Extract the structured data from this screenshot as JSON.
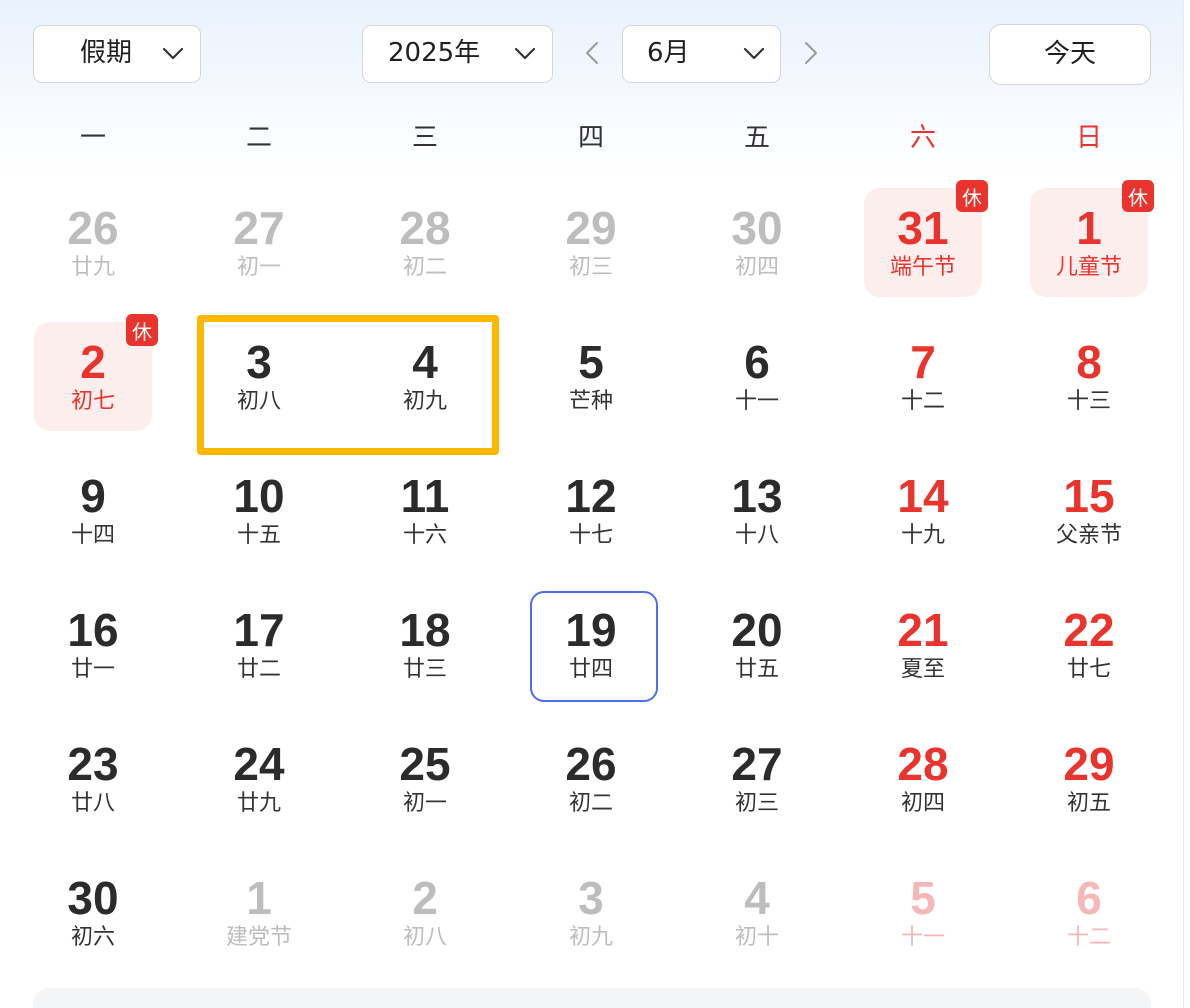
{
  "toolbar": {
    "holiday_select": {
      "value": "假期"
    },
    "year_select": {
      "value": "2025年"
    },
    "month_select": {
      "value": "6月"
    },
    "today_button": {
      "label": "今天"
    }
  },
  "icons": {
    "dropdown": "chevron-down-icon",
    "prev_month": "chevron-left-icon",
    "next_month": "chevron-right-icon"
  },
  "colors": {
    "text": "#2b2b2b",
    "muted": "#bdbdbd",
    "red": "#e8342d",
    "red_muted": "#f5b7b7",
    "holiday_bg": "#fdeeee",
    "badge_bg": "#e8342d",
    "range_border": "#ffb800",
    "today_border": "#4d6ef0"
  },
  "rest_badge": "休",
  "weekdays": [
    {
      "label": "一"
    },
    {
      "label": "二"
    },
    {
      "label": "三"
    },
    {
      "label": "四"
    },
    {
      "label": "五"
    },
    {
      "label": "六",
      "red": true
    },
    {
      "label": "日",
      "red": true
    }
  ],
  "weeks": [
    [
      {
        "day": "26",
        "lunar": "廿九",
        "muted": true
      },
      {
        "day": "27",
        "lunar": "初一",
        "muted": true
      },
      {
        "day": "28",
        "lunar": "初二",
        "muted": true
      },
      {
        "day": "29",
        "lunar": "初三",
        "muted": true
      },
      {
        "day": "30",
        "lunar": "初四",
        "muted": true
      },
      {
        "day": "31",
        "lunar": "端午节",
        "rest": true
      },
      {
        "day": "1",
        "lunar": "儿童节",
        "rest": true
      }
    ],
    [
      {
        "day": "2",
        "lunar": "初七",
        "rest": true
      },
      {
        "day": "3",
        "lunar": "初八",
        "range_start": true
      },
      {
        "day": "4",
        "lunar": "初九",
        "range_end": true
      },
      {
        "day": "5",
        "lunar": "芒种"
      },
      {
        "day": "6",
        "lunar": "十一"
      },
      {
        "day": "7",
        "lunar": "十二",
        "weekend": true
      },
      {
        "day": "8",
        "lunar": "十三",
        "weekend": true
      }
    ],
    [
      {
        "day": "9",
        "lunar": "十四"
      },
      {
        "day": "10",
        "lunar": "十五"
      },
      {
        "day": "11",
        "lunar": "十六"
      },
      {
        "day": "12",
        "lunar": "十七"
      },
      {
        "day": "13",
        "lunar": "十八"
      },
      {
        "day": "14",
        "lunar": "十九",
        "weekend": true
      },
      {
        "day": "15",
        "lunar": "父亲节",
        "weekend": true
      }
    ],
    [
      {
        "day": "16",
        "lunar": "廿一"
      },
      {
        "day": "17",
        "lunar": "廿二"
      },
      {
        "day": "18",
        "lunar": "廿三"
      },
      {
        "day": "19",
        "lunar": "廿四",
        "today": true
      },
      {
        "day": "20",
        "lunar": "廿五"
      },
      {
        "day": "21",
        "lunar": "夏至",
        "weekend": true
      },
      {
        "day": "22",
        "lunar": "廿七",
        "weekend": true
      }
    ],
    [
      {
        "day": "23",
        "lunar": "廿八"
      },
      {
        "day": "24",
        "lunar": "廿九"
      },
      {
        "day": "25",
        "lunar": "初一"
      },
      {
        "day": "26",
        "lunar": "初二"
      },
      {
        "day": "27",
        "lunar": "初三"
      },
      {
        "day": "28",
        "lunar": "初四",
        "weekend": true
      },
      {
        "day": "29",
        "lunar": "初五",
        "weekend": true
      }
    ],
    [
      {
        "day": "30",
        "lunar": "初六"
      },
      {
        "day": "1",
        "lunar": "建党节",
        "muted": true
      },
      {
        "day": "2",
        "lunar": "初八",
        "muted": true
      },
      {
        "day": "3",
        "lunar": "初九",
        "muted": true
      },
      {
        "day": "4",
        "lunar": "初十",
        "muted": true
      },
      {
        "day": "5",
        "lunar": "十一",
        "muted": true,
        "weekend": true
      },
      {
        "day": "6",
        "lunar": "十二",
        "muted": true,
        "weekend": true
      }
    ]
  ]
}
